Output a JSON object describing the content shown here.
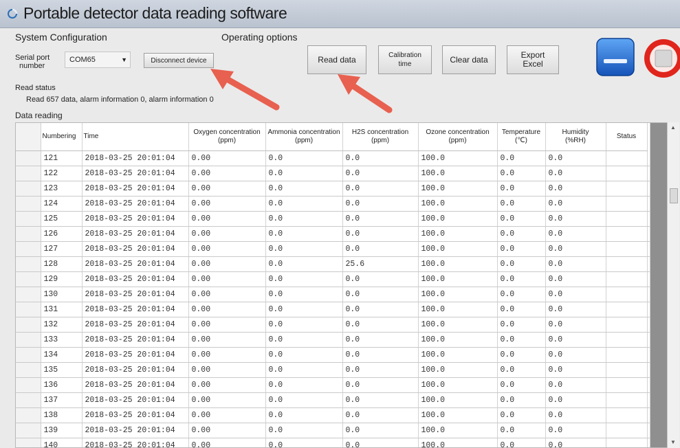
{
  "window": {
    "title": "Portable detector data reading software"
  },
  "system_config": {
    "group_label": "System Configuration",
    "serial_port_label_line1": "Serial port",
    "serial_port_label_line2": "number",
    "serial_port_value": "COM65",
    "disconnect_label": "Disconnect device"
  },
  "operating_options": {
    "group_label": "Operating options",
    "read_data_label": "Read data",
    "calibration_label_line1": "Calibration",
    "calibration_label_line2": "time",
    "clear_data_label": "Clear data",
    "export_label_line1": "Export",
    "export_label_line2": "Excel"
  },
  "read_status": {
    "label": "Read status",
    "text": "Read 657 data, alarm information 0, alarm information 0"
  },
  "data_reading": {
    "label": "Data reading",
    "columns": [
      {
        "name": "Numbering",
        "unit": ""
      },
      {
        "name": "Time",
        "unit": ""
      },
      {
        "name": "Oxygen concentration",
        "unit": "(ppm)"
      },
      {
        "name": "Ammonia concentration",
        "unit": "(ppm)"
      },
      {
        "name": "H2S concentration",
        "unit": "(ppm)"
      },
      {
        "name": "Ozone concentration",
        "unit": "(ppm)"
      },
      {
        "name": "Temperature",
        "unit": "(℃)"
      },
      {
        "name": "Humidity",
        "unit": "(%RH)"
      },
      {
        "name": "Status",
        "unit": ""
      }
    ],
    "rows": [
      [
        "121",
        "2018-03-25 20:01:04",
        "0.00",
        "0.0",
        "0.0",
        "100.0",
        "0.0",
        "0.0",
        ""
      ],
      [
        "122",
        "2018-03-25 20:01:04",
        "0.00",
        "0.0",
        "0.0",
        "100.0",
        "0.0",
        "0.0",
        ""
      ],
      [
        "123",
        "2018-03-25 20:01:04",
        "0.00",
        "0.0",
        "0.0",
        "100.0",
        "0.0",
        "0.0",
        ""
      ],
      [
        "124",
        "2018-03-25 20:01:04",
        "0.00",
        "0.0",
        "0.0",
        "100.0",
        "0.0",
        "0.0",
        ""
      ],
      [
        "125",
        "2018-03-25 20:01:04",
        "0.00",
        "0.0",
        "0.0",
        "100.0",
        "0.0",
        "0.0",
        ""
      ],
      [
        "126",
        "2018-03-25 20:01:04",
        "0.00",
        "0.0",
        "0.0",
        "100.0",
        "0.0",
        "0.0",
        ""
      ],
      [
        "127",
        "2018-03-25 20:01:04",
        "0.00",
        "0.0",
        "0.0",
        "100.0",
        "0.0",
        "0.0",
        ""
      ],
      [
        "128",
        "2018-03-25 20:01:04",
        "0.00",
        "0.0",
        "25.6",
        "100.0",
        "0.0",
        "0.0",
        ""
      ],
      [
        "129",
        "2018-03-25 20:01:04",
        "0.00",
        "0.0",
        "0.0",
        "100.0",
        "0.0",
        "0.0",
        ""
      ],
      [
        "130",
        "2018-03-25 20:01:04",
        "0.00",
        "0.0",
        "0.0",
        "100.0",
        "0.0",
        "0.0",
        ""
      ],
      [
        "131",
        "2018-03-25 20:01:04",
        "0.00",
        "0.0",
        "0.0",
        "100.0",
        "0.0",
        "0.0",
        ""
      ],
      [
        "132",
        "2018-03-25 20:01:04",
        "0.00",
        "0.0",
        "0.0",
        "100.0",
        "0.0",
        "0.0",
        ""
      ],
      [
        "133",
        "2018-03-25 20:01:04",
        "0.00",
        "0.0",
        "0.0",
        "100.0",
        "0.0",
        "0.0",
        ""
      ],
      [
        "134",
        "2018-03-25 20:01:04",
        "0.00",
        "0.0",
        "0.0",
        "100.0",
        "0.0",
        "0.0",
        ""
      ],
      [
        "135",
        "2018-03-25 20:01:04",
        "0.00",
        "0.0",
        "0.0",
        "100.0",
        "0.0",
        "0.0",
        ""
      ],
      [
        "136",
        "2018-03-25 20:01:04",
        "0.00",
        "0.0",
        "0.0",
        "100.0",
        "0.0",
        "0.0",
        ""
      ],
      [
        "137",
        "2018-03-25 20:01:04",
        "0.00",
        "0.0",
        "0.0",
        "100.0",
        "0.0",
        "0.0",
        ""
      ],
      [
        "138",
        "2018-03-25 20:01:04",
        "0.00",
        "0.0",
        "0.0",
        "100.0",
        "0.0",
        "0.0",
        ""
      ],
      [
        "139",
        "2018-03-25 20:01:04",
        "0.00",
        "0.0",
        "0.0",
        "100.0",
        "0.0",
        "0.0",
        ""
      ],
      [
        "140",
        "2018-03-25 20:01:04",
        "0.00",
        "0.0",
        "0.0",
        "100.0",
        "0.0",
        "0.0",
        ""
      ]
    ]
  },
  "icons": {
    "app": "app-logo-icon",
    "minimize": "minimize-icon",
    "close": "close-icon",
    "annotation": "red-arrow-icon"
  },
  "colors": {
    "minimize_blue": "#1f6fd6",
    "close_red": "#e0251c",
    "annotation_arrow": "#e8604f"
  }
}
